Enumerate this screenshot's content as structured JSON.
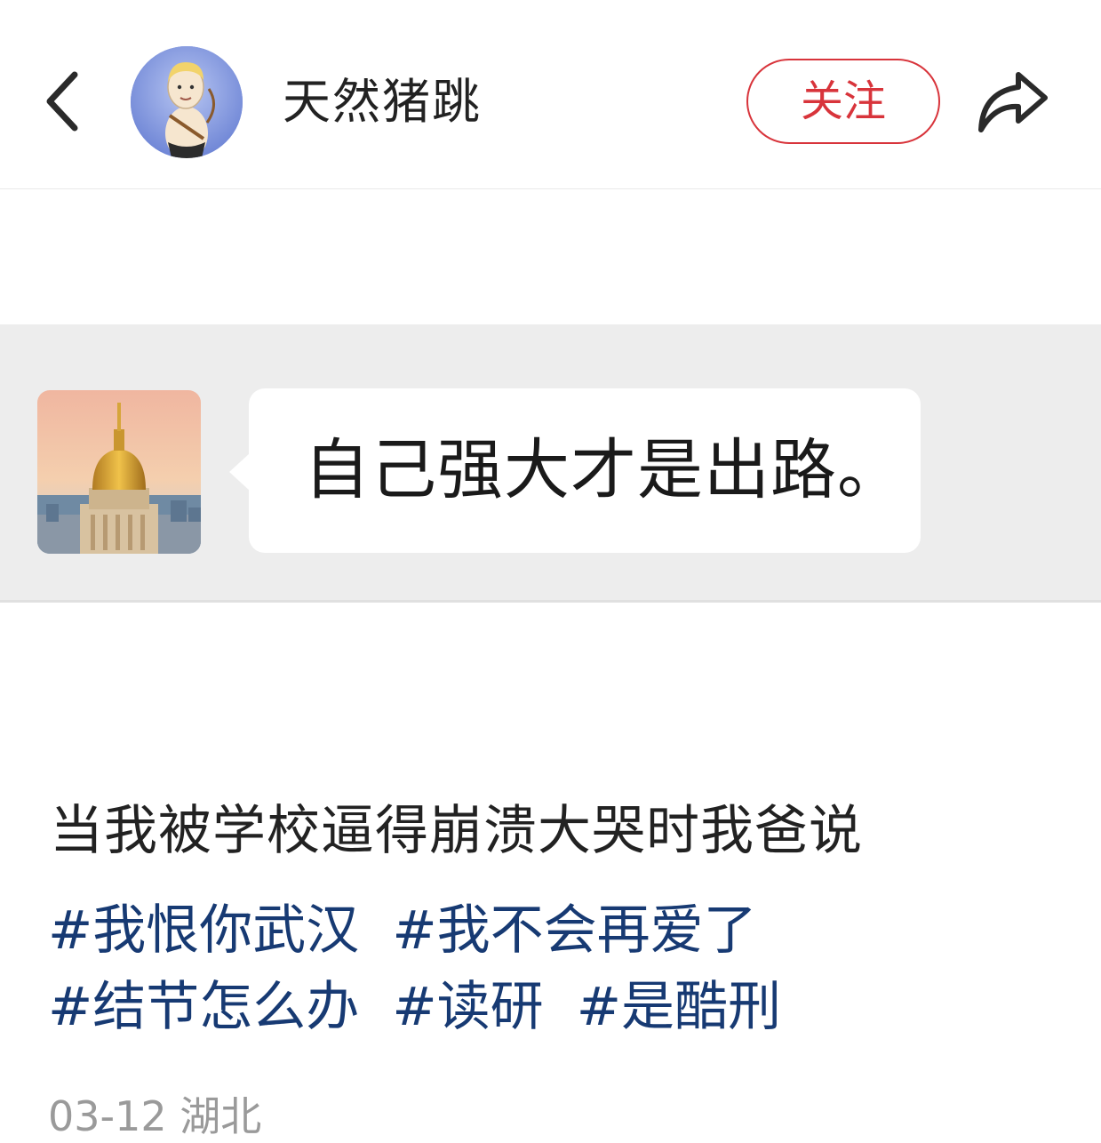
{
  "header": {
    "username": "天然猪跳",
    "follow_label": "关注",
    "back_icon": "chevron-left-icon",
    "share_icon": "share-arrow-icon"
  },
  "chat_image": {
    "message": "自己强大才是出路。"
  },
  "post": {
    "title": "当我被学校逼得崩溃大哭时我爸说",
    "tags": [
      "#我恨你武汉",
      "#我不会再爱了",
      "#结节怎么办",
      "#读研",
      "#是酷刑"
    ],
    "date": "03-12",
    "location": "湖北"
  },
  "colors": {
    "follow_red": "#d8343b",
    "tag_blue": "#173a73",
    "meta_gray": "#9a9a9a",
    "chat_bg": "#ededed"
  }
}
